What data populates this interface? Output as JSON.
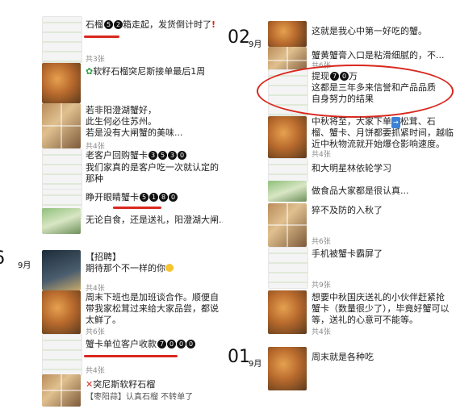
{
  "left": {
    "date_partial": "6",
    "date_month": "9月",
    "posts": [
      {
        "text_parts": [
          "石榴",
          "箱走起，发货倒计时了"
        ],
        "badges": [
          "5",
          "2"
        ],
        "mark": "!"
      },
      {
        "meta": "共3张"
      },
      {
        "text": "软籽石榴突尼斯接单最后1周"
      },
      {
        "lines": [
          "若非阳澄湖蟹好，",
          "此生何必住苏州。",
          "若是没有大闸蟹的美味..."
        ],
        "meta": "共4张"
      },
      {
        "text_prefix": "老客户回购蟹卡",
        "badges": [
          "3",
          "5",
          "3",
          "0"
        ],
        "lines": [
          "我们家真的是客户吃一次就认定的",
          "那种"
        ]
      },
      {
        "text_prefix": "睁开眼睛蟹卡",
        "badges": [
          "5",
          "1",
          "8",
          "0"
        ]
      },
      {
        "lines": [
          "无论自食，还是送礼，阳澄湖大闸..."
        ]
      },
      {
        "lines": [
          "【招聘】",
          "期待那个不一样的你"
        ],
        "meta": "共4张"
      },
      {
        "lines": [
          "周末下班也是加班谈合作。顺便自",
          "带我家松茸过来给大家品尝，都说",
          "太鲜了。"
        ],
        "meta": "共6张"
      },
      {
        "text_prefix": "蟹卡单位客户收款",
        "badges": [
          "7",
          "0",
          "0",
          "0"
        ],
        "meta": "共4张"
      },
      {
        "text": "突尼斯软籽石榴",
        "text2": "【枣阳蒜】认真石榴 不转单了"
      }
    ]
  },
  "right": {
    "date_day_02": "02",
    "date_month_02": "9月",
    "date_day_01": "01",
    "date_month_01": "9月",
    "posts": [
      {
        "text": "这就是我心中第一好吃的蟹。"
      },
      {
        "text": "蟹黄蟹膏入口是粘滑细腻的，不...",
        "meta": "共6张"
      },
      {
        "text_prefix": "提现",
        "badges": [
          "7",
          "0"
        ],
        "text_suffix": "万",
        "lines": [
          "这都是三年多来信誉和产品品质",
          "自身努力的结果"
        ]
      },
      {
        "lines": [
          "中秋将至，大家下单",
          "松茸、石",
          "榴、蟹卡、月饼都要抓紧时间，越临",
          "近中秋物流就开始爆仓影响速度。"
        ],
        "arrow": "→",
        "meta": "共4张"
      },
      {
        "text": "和大明星林依轮学习"
      },
      {
        "text": "做食品大家都是很认真..."
      },
      {
        "text": "猝不及防的入秋了",
        "meta": "共6张"
      },
      {
        "text": "手机被蟹卡霸屏了",
        "meta": "共9张"
      },
      {
        "lines": [
          "想要中秋国庆送礼的小伙伴赶紧抢",
          "蟹卡（数量很少了），毕竟好蟹可以",
          "等，送礼的心意可不能等。"
        ],
        "meta": "共4张"
      },
      {
        "text": "周末就是各种吃"
      }
    ]
  },
  "colors": {
    "accent_red": "#d9281e",
    "meta_gray": "#8a8a8a"
  }
}
